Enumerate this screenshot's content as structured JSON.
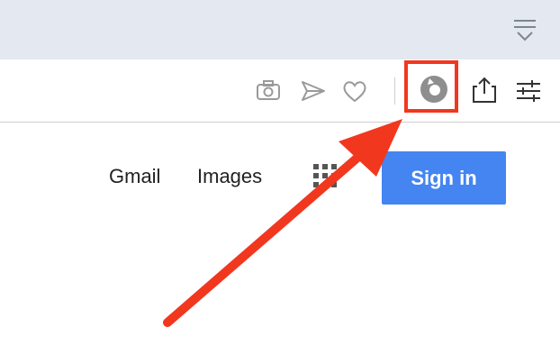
{
  "links": {
    "gmail": "Gmail",
    "images": "Images"
  },
  "signin": {
    "label": "Sign in"
  },
  "icons": {
    "tab_menu": "tab-menu-icon",
    "camera": "camera-icon",
    "send": "send-icon",
    "heart": "heart-icon",
    "extension": "extension-icon",
    "share": "share-icon",
    "settings": "settings-sliders-icon",
    "apps": "apps-grid-icon"
  },
  "colors": {
    "highlight": "#f2371f",
    "signin_bg": "#4485f1",
    "tabbar_bg": "#e3e8f1"
  }
}
